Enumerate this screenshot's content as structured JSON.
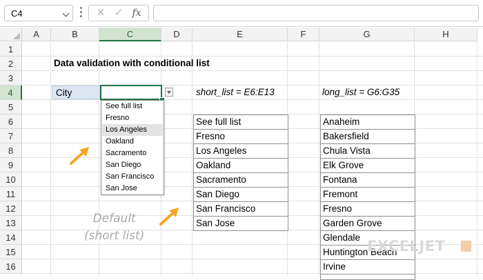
{
  "formula_bar": {
    "name_box": "C4",
    "formula": "",
    "icons": [
      "cancel-x-icon",
      "enter-check-icon",
      "fx-icon"
    ]
  },
  "columns": [
    "A",
    "B",
    "C",
    "D",
    "E",
    "F",
    "G",
    "H"
  ],
  "rows": [
    "1",
    "2",
    "3",
    "4",
    "5",
    "6",
    "7",
    "8",
    "9",
    "10",
    "11",
    "12",
    "13",
    "14",
    "15",
    "16"
  ],
  "selected_cell": {
    "column": "C",
    "row": "4"
  },
  "sheet": {
    "title": "Data validation with conditional list",
    "city_label": "City",
    "city_value": "",
    "short_list_label": "short_list = E6:E13",
    "long_list_label": "long_list = G6:G35"
  },
  "dropdown": {
    "items": [
      "See full list",
      "Fresno",
      "Los Angeles",
      "Oakland",
      "Sacramento",
      "San Diego",
      "San Francisco",
      "San Jose"
    ],
    "highlighted": "Los Angeles"
  },
  "short_list": [
    "See full list",
    "Fresno",
    "Los Angeles",
    "Oakland",
    "Sacramento",
    "San Diego",
    "San Francisco",
    "San Jose"
  ],
  "long_list": [
    "Anaheim",
    "Bakersfield",
    "Chula Vista",
    "Elk Grove",
    "Fontana",
    "Fremont",
    "Fresno",
    "Garden Grove",
    "Glendale",
    "Huntington Beach",
    "Irvine"
  ],
  "annotation": {
    "line1": "Default",
    "line2": "(short list)"
  },
  "colors": {
    "accent": "#217346",
    "arrow": "#f5a623",
    "city_fill": "#dce6f1",
    "highlight": "#e3e3e3"
  },
  "watermark": "EXCELJET"
}
